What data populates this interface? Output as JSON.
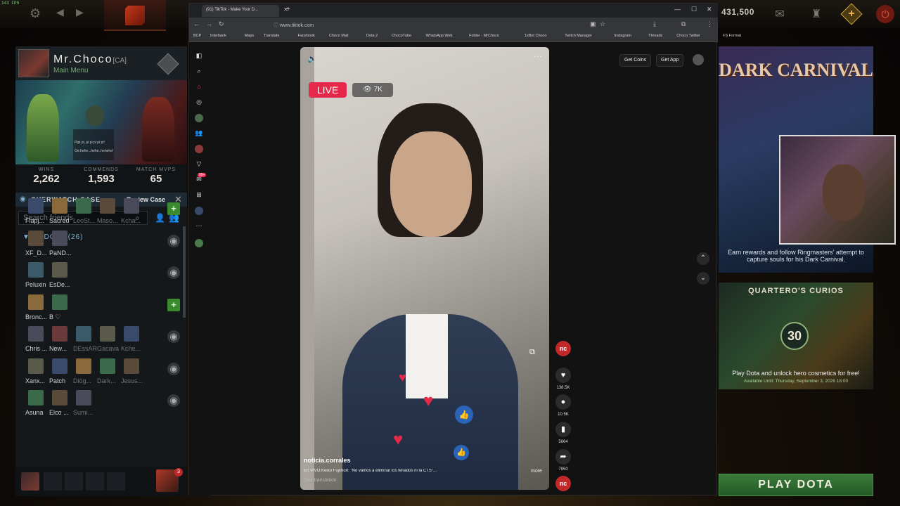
{
  "fps": "143 FPS",
  "gold": "431,500",
  "profile": {
    "name": "Mr.Choco",
    "tag": "[CA]",
    "menu": "Main Menu",
    "mini_lines": [
      "Pipi pi, pi pi pi pi pi!",
      "Oe.hehe...hehe..hehehe!"
    ]
  },
  "stats": [
    {
      "label": "WINS",
      "value": "2,262"
    },
    {
      "label": "COMMENDS",
      "value": "1,593"
    },
    {
      "label": "MATCH MVPS",
      "value": "65"
    }
  ],
  "overwatch": {
    "title": "OVERWATCH CASE",
    "action": "Review Case"
  },
  "search": {
    "placeholder": "Search friends"
  },
  "friends": {
    "group": "IN DOTA (26)",
    "rows": [
      {
        "names": [
          "Flapj...",
          "Sacred",
          "LeoSt...",
          "Maso...",
          "Kcha..."
        ],
        "action": "add"
      },
      {
        "names": [
          "XF_D...",
          "PaND..."
        ],
        "action": "eye"
      },
      {
        "names": [
          "Peluxin",
          "EsDe..."
        ],
        "action": "eye"
      },
      {
        "names": [
          "Bronc...",
          "B ♡"
        ],
        "action": "add"
      },
      {
        "names": [
          "Chris ...",
          "New...",
          "DEssAR",
          "Gacava",
          "Kche..."
        ],
        "action": "eye"
      },
      {
        "names": [
          "Xanx...",
          "Patch",
          "Diòg...",
          "Dark...",
          "Jesus..."
        ],
        "action": "eye"
      },
      {
        "names": [
          "Asuna",
          "Elco ...",
          "Sumi..."
        ],
        "action": "eye"
      }
    ]
  },
  "bottom": {
    "badge": "3"
  },
  "browser": {
    "tab_title": "(91) TikTok - Make Your D...",
    "url": "www.tiktok.com",
    "bookmarks": [
      "BCP",
      "Interbank",
      "Maps",
      "Translate",
      "Facebook",
      "Choco Mail",
      "Dota 2",
      "ChocoTube",
      "WhatsApp Web",
      "Folder - MrChoco",
      "1xBet Choco",
      "Twitch Manager",
      "Instagram",
      "Threads",
      "Choco Twitter",
      "FS Format"
    ]
  },
  "tiktok": {
    "live": "LIVE",
    "viewers": "7K",
    "get_coins": "Get Coins",
    "get_app": "Get App",
    "creator": "noticia.corrales",
    "caption": "En VIVO:Keiko Fujimori: \"No vamos a eliminar los feriados ni la CTS\"...",
    "more": "more",
    "see_translation": "See translation",
    "likes": "138.5K",
    "comments": "10.5K",
    "saves": "5664",
    "shares": "7950",
    "sidebar_badge": "99+"
  },
  "carnival": {
    "title": "DARK CARNIVAL",
    "text": "Earn rewards and follow Ringmasters' attempt to capture souls for his Dark Carnival."
  },
  "curios": {
    "title": "QUARTERO'S CURIOS",
    "count": "30",
    "text": "Play Dota and unlock hero cosmetics for free!",
    "available": "Available Until:  Thursday, September 3, 2026 18:00"
  },
  "play": "PLAY DOTA",
  "colors": {
    "live": "#e6284a",
    "play": "#2f6e30",
    "gold_accent": "#c9a23c"
  }
}
